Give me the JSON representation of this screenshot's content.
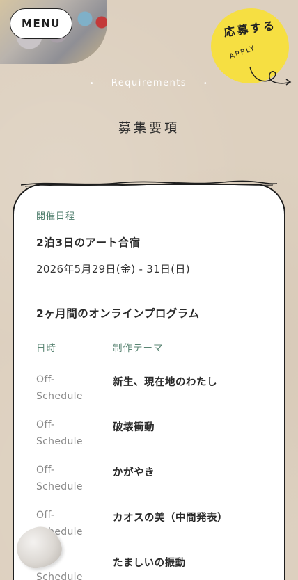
{
  "header": {
    "menu_label": "MENU",
    "apply_jp": "応募する",
    "apply_en": "APPLY"
  },
  "section": {
    "label": "Requirements",
    "title": "募集要項"
  },
  "schedule": {
    "field_label": "開催日程",
    "camp_title": "2泊3日のアート合宿",
    "camp_dates": "2026年5月29日(金) - 31日(日)",
    "program_title": "2ヶ月間のオンラインプログラム",
    "columns": {
      "date": "日時",
      "theme": "制作テーマ"
    },
    "rows": [
      {
        "date_1": "Off-",
        "date_2": "Schedule",
        "theme": "新生、現在地のわたし"
      },
      {
        "date_1": "Off-",
        "date_2": "Schedule",
        "theme": "破壊衝動"
      },
      {
        "date_1": "Off-",
        "date_2": "Schedule",
        "theme": "かがやき"
      },
      {
        "date_1": "Off-",
        "date_2": "Schedule",
        "theme": "カオスの美（中間発表）"
      },
      {
        "date_1": "Off-",
        "date_2": "Schedule",
        "theme": "たましいの振動"
      }
    ]
  },
  "colors": {
    "background": "#ddd0bf",
    "accent_green": "#4a7a68",
    "badge_yellow": "#f6df42"
  }
}
